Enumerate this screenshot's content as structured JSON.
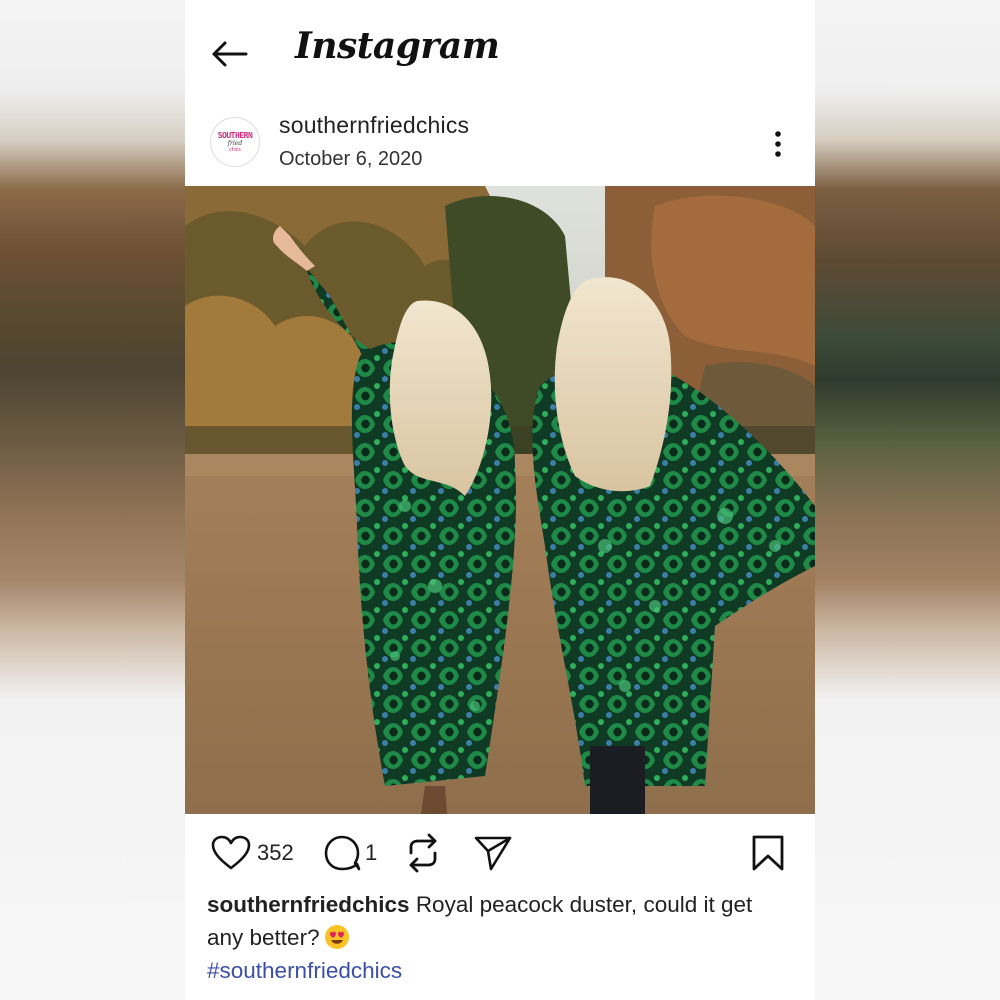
{
  "app": {
    "title": "Instagram"
  },
  "post": {
    "username": "southernfriedchics",
    "date": "October 6, 2020",
    "avatar_text_top": "SOUTHERN",
    "avatar_text_mid": "fried",
    "avatar_text_bottom": "chics",
    "likes": "352",
    "comments": "1",
    "caption": {
      "username": "southernfriedchics",
      "text": "Royal peacock duster, could it get any better?",
      "hashtag": "#southernfriedchics"
    }
  },
  "icons": {
    "back": "back-arrow-icon",
    "more": "more-vertical-icon",
    "like": "heart-icon",
    "comment": "comment-icon",
    "repost": "repost-icon",
    "share": "send-icon",
    "save": "bookmark-icon",
    "emoji": "heart-eyes-emoji"
  },
  "colors": {
    "text": "#222222",
    "hashtag": "#3b4fa8",
    "brand_pink": "#d6247a",
    "background": "#ffffff"
  }
}
